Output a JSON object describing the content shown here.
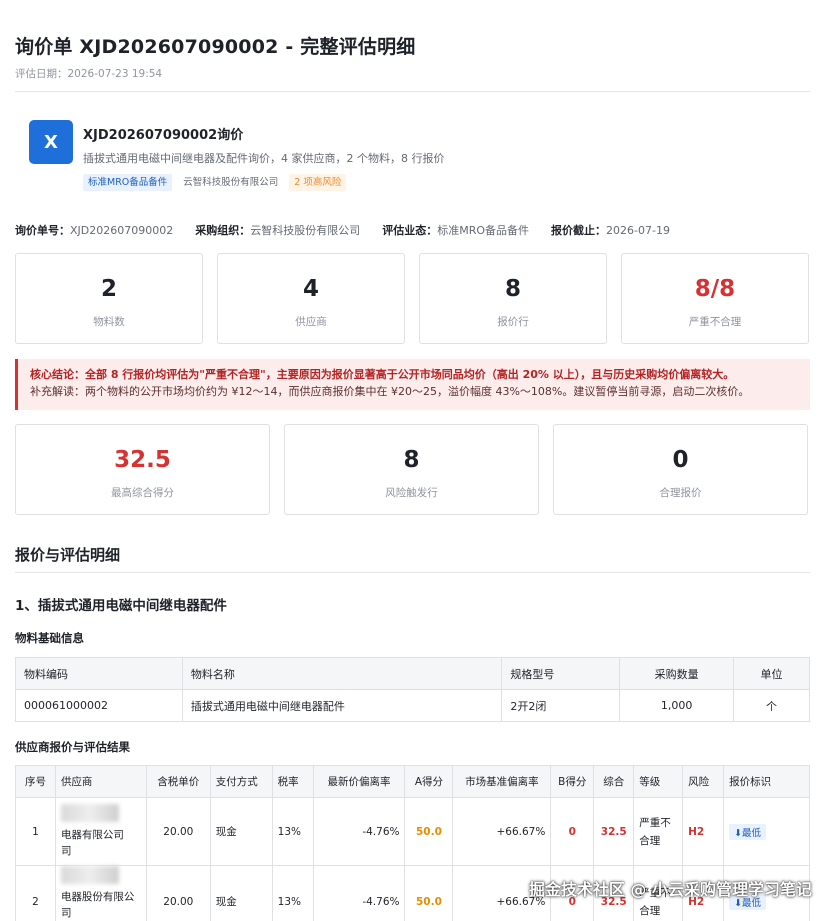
{
  "page": {
    "title": "询价单 XJD202607090002 - 完整评估明细",
    "date": "评估日期：2026-07-23 19:54"
  },
  "header": {
    "avatar_letter": "X",
    "name": "XJD202607090002询价",
    "desc": "插拔式通用电磁中间继电器及配件询价，4 家供应商，2 个物料，8 行报价",
    "tags": [
      "标准MRO备品备件",
      "云智科技股份有限公司",
      "2 项高风险"
    ]
  },
  "meta": [
    {
      "label": "询价单号：",
      "value": "XJD202607090002"
    },
    {
      "label": "采购组织：",
      "value": "云智科技股份有限公司"
    },
    {
      "label": "评估业态：",
      "value": "标准MRO备品备件"
    },
    {
      "label": "报价截止：",
      "value": "2026-07-19"
    }
  ],
  "stats1": [
    {
      "value": "2",
      "label": "物料数"
    },
    {
      "value": "4",
      "label": "供应商"
    },
    {
      "value": "8",
      "label": "报价行"
    },
    {
      "value": "8/8",
      "label": "严重不合理"
    }
  ],
  "alert": {
    "line1": "核心结论：全部 8 行报价均评估为\"严重不合理\"，主要原因为报价显著高于公开市场同品均价（高出 20% 以上），且与历史采购均价偏离较大。",
    "line2": "补充解读：两个物料的公开市场均价约为 ¥12～14，而供应商报价集中在 ¥20～25，溢价幅度 43%～108%。建议暂停当前寻源，启动二次核价。"
  },
  "stats2": [
    {
      "value": "32.5",
      "label": "最高综合得分"
    },
    {
      "value": "8",
      "label": "风险触发行"
    },
    {
      "value": "0",
      "label": "合理报价"
    }
  ],
  "section": {
    "title": "报价与评估明细",
    "sub": "1、插拔式通用电磁中间继电器配件",
    "material_label": "物料基础信息",
    "quote_label": "供应商报价与评估结果"
  },
  "material_table": {
    "headers": [
      "物料编码",
      "物料名称",
      "规格型号",
      "采购数量",
      "单位"
    ],
    "rows": [
      [
        "000061000002",
        "插拔式通用电磁中间继电器配件",
        "2开2闭",
        "1,000",
        "个"
      ]
    ]
  },
  "quote_table": {
    "headers": [
      "序号",
      "供应商",
      "含税单价",
      "支付方式",
      "税率",
      "最新价偏离率",
      "A得分",
      "市场基准偏离率",
      "B得分",
      "综合",
      "等级",
      "风险",
      "报价标识"
    ],
    "rows": [
      {
        "idx": "1",
        "supplier": "电器有限公司",
        "supplier_tail": "司",
        "price": "20.00",
        "pay": "现金",
        "tax": "13%",
        "dev1": "-4.76%",
        "a": "50.0",
        "dev2": "+66.67%",
        "b": "0",
        "total": "32.5",
        "grade": "严重不合理",
        "risk": "H2",
        "badge": "⬇最低"
      },
      {
        "idx": "2",
        "supplier": "电器股份有限公司",
        "supplier_tail": "公司",
        "price": "20.00",
        "pay": "现金",
        "tax": "13%",
        "dev1": "-4.76%",
        "a": "50.0",
        "dev2": "+66.67%",
        "b": "0",
        "total": "32.5",
        "grade": "严重不合理",
        "risk": "H2",
        "badge": "⬇最低"
      }
    ]
  },
  "watermark": "掘金技术社区 @ 小云采购管理学习笔记",
  "colors": {
    "brand": "#1e6fd9",
    "danger": "#d63232",
    "warn": "#e88c00"
  }
}
